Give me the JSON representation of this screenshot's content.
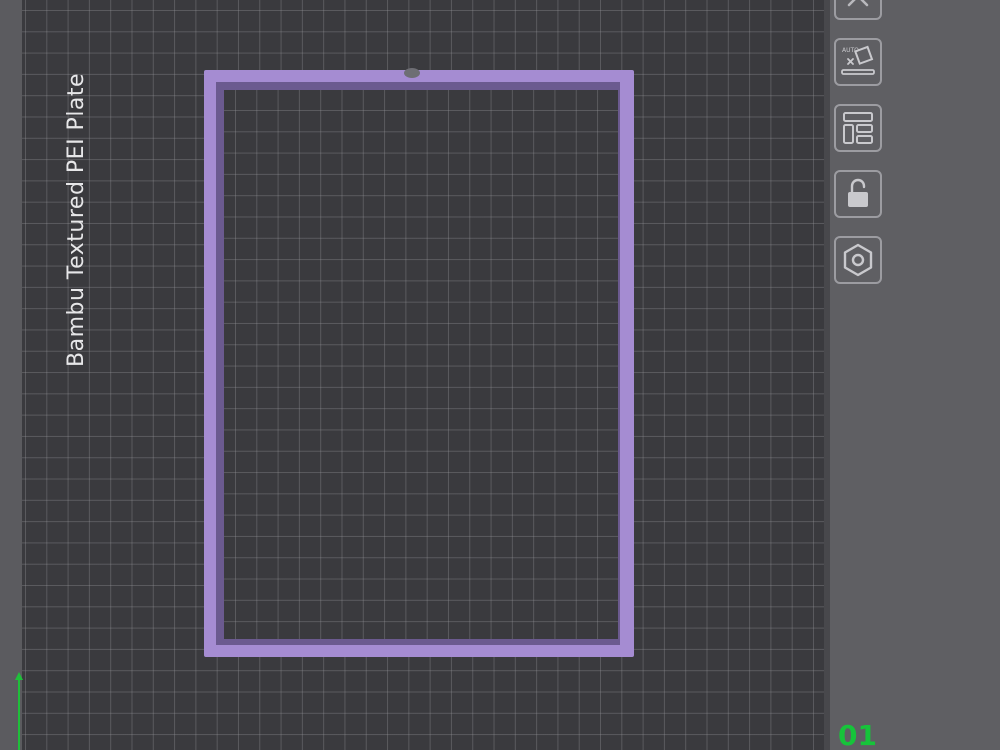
{
  "plate": {
    "name": "Bambu Textured PEI Plate",
    "number": "01"
  },
  "model": {
    "color": "#a58cd2"
  },
  "toolbar": {
    "items": [
      {
        "name": "close",
        "icon": "close-icon"
      },
      {
        "name": "auto-orient",
        "icon": "auto-orient-icon",
        "label": "AUTO"
      },
      {
        "name": "arrange",
        "icon": "arrange-icon"
      },
      {
        "name": "lock",
        "icon": "unlock-icon"
      },
      {
        "name": "plate-settings",
        "icon": "hexagon-settings-icon"
      }
    ]
  },
  "colors": {
    "bed": "#3a3a3e",
    "panel": "#5f5f63",
    "plate_number": "#16c43a",
    "y_axis": "#1fbf3a"
  }
}
